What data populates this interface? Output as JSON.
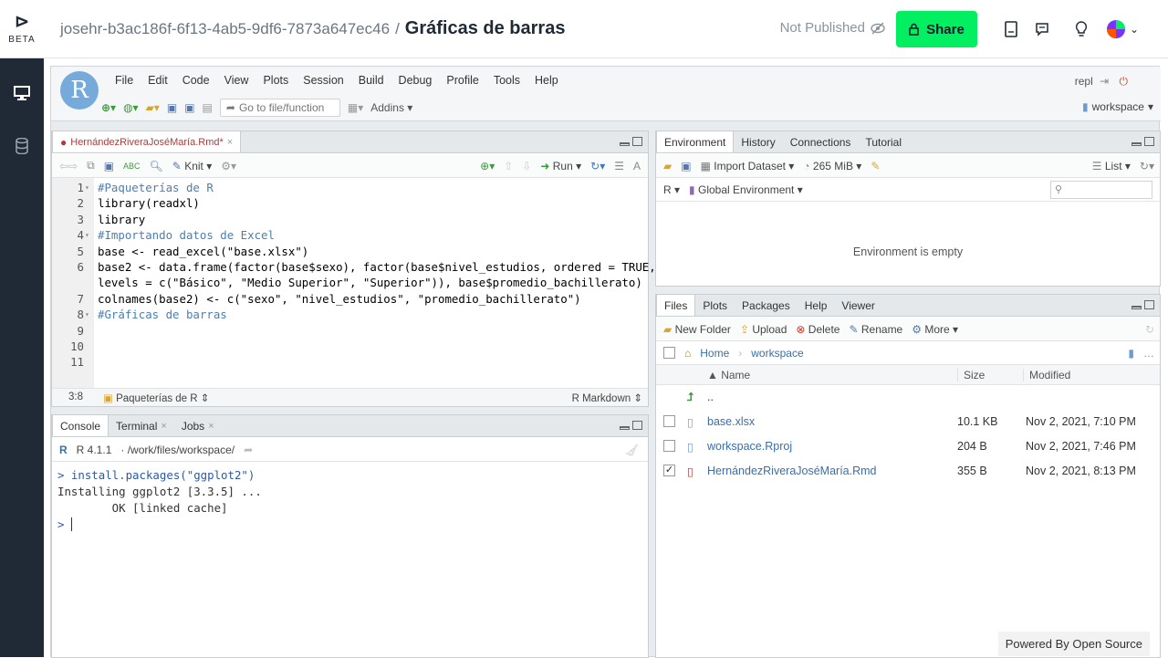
{
  "app": {
    "logo_mark": "⊳",
    "beta_label": "BETA"
  },
  "header": {
    "project_id": "josehr-b3ac186f-6f13-4ab5-9df6-7873a647ec46",
    "separator": "/",
    "title": "Gráficas de barras",
    "status": "Not Published",
    "share_label": "Share"
  },
  "rstudio": {
    "menu": [
      "File",
      "Edit",
      "Code",
      "View",
      "Plots",
      "Session",
      "Build",
      "Debug",
      "Profile",
      "Tools",
      "Help"
    ],
    "goto_placeholder": "Go to file/function",
    "addins_label": "Addins",
    "repl_label": "repl",
    "project_label": "workspace"
  },
  "editor": {
    "tab_label": "HernándezRiveraJoséMaría.Rmd*",
    "knit_label": "Knit",
    "run_label": "Run",
    "lines": [
      {
        "n": "1",
        "fold": "▾",
        "text": "#Paqueterías de R",
        "comment": true
      },
      {
        "n": "2",
        "fold": "",
        "text": "library(readxl)",
        "comment": false
      },
      {
        "n": "3",
        "fold": "",
        "text": "library",
        "comment": false
      },
      {
        "n": "4",
        "fold": "▾",
        "text": "#Importando datos de Excel",
        "comment": true
      },
      {
        "n": "5",
        "fold": "",
        "text": "base <- read_excel(\"base.xlsx\")",
        "comment": false
      },
      {
        "n": "6",
        "fold": "",
        "text": "base2 <- data.frame(factor(base$sexo), factor(base$nivel_estudios, ordered = TRUE,",
        "comment": false
      },
      {
        "n": "",
        "fold": "",
        "text": "levels = c(\"Básico\", \"Medio Superior\", \"Superior\")), base$promedio_bachillerato)",
        "comment": false
      },
      {
        "n": "7",
        "fold": "",
        "text": "colnames(base2) <- c(\"sexo\", \"nivel_estudios\", \"promedio_bachillerato\")",
        "comment": false
      },
      {
        "n": "8",
        "fold": "▾",
        "text": "#Gráficas de barras",
        "comment": true
      },
      {
        "n": "9",
        "fold": "",
        "text": "",
        "comment": false
      },
      {
        "n": "10",
        "fold": "",
        "text": "",
        "comment": false
      },
      {
        "n": "11",
        "fold": "",
        "text": "",
        "comment": false
      }
    ],
    "cursor_pos": "3:8",
    "section_label": "Paqueterías de R",
    "mode_label": "R Markdown"
  },
  "console": {
    "tabs": [
      "Console",
      "Terminal",
      "Jobs"
    ],
    "r_version": "R 4.1.1",
    "path": "/work/files/workspace/",
    "lines": [
      "> install.packages(\"ggplot2\")",
      "Installing ggplot2 [3.3.5] ...",
      "        OK [linked cache]"
    ],
    "prompt": ">"
  },
  "environment": {
    "tabs": [
      "Environment",
      "History",
      "Connections",
      "Tutorial"
    ],
    "import_label": "Import Dataset",
    "memory_label": "265 MiB",
    "list_label": "List",
    "lang_label": "R",
    "scope_label": "Global Environment",
    "empty_message": "Environment is empty"
  },
  "files": {
    "tabs": [
      "Files",
      "Plots",
      "Packages",
      "Help",
      "Viewer"
    ],
    "actions": [
      "New Folder",
      "Upload",
      "Delete",
      "Rename",
      "More"
    ],
    "breadcrumb": [
      "Home",
      "workspace"
    ],
    "columns": [
      "Name",
      "Size",
      "Modified"
    ],
    "up_label": "..",
    "rows": [
      {
        "name": "base.xlsx",
        "size": "10.1 KB",
        "modified": "Nov 2, 2021, 7:10 PM",
        "checked": ""
      },
      {
        "name": "workspace.Rproj",
        "size": "204 B",
        "modified": "Nov 2, 2021, 7:46 PM",
        "checked": ""
      },
      {
        "name": "HernándezRiveraJoséMaría.Rmd",
        "size": "355 B",
        "modified": "Nov 2, 2021, 8:13 PM",
        "checked": "✓"
      }
    ]
  },
  "footer": {
    "powered_by": "Powered By Open Source"
  }
}
